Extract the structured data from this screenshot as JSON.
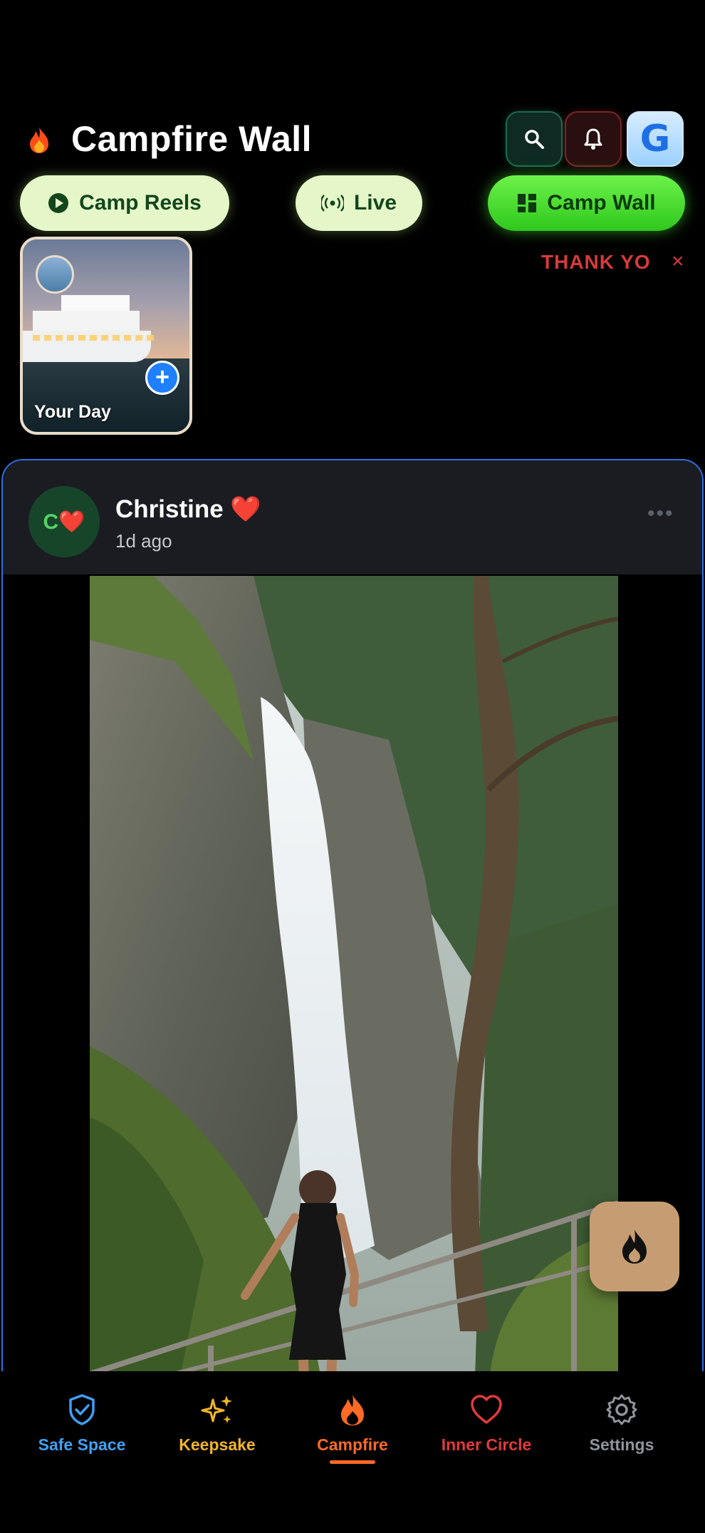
{
  "header": {
    "title": "Campfire Wall",
    "title_icon": "flame-icon",
    "buttons": [
      {
        "name": "search",
        "icon": "search-icon"
      },
      {
        "name": "notifications",
        "icon": "bell-icon"
      },
      {
        "name": "account",
        "icon": "g-logo",
        "letter": "G"
      }
    ]
  },
  "tabs": {
    "reels_label": "Camp Reels",
    "live_label": "Live",
    "wall_label": "Camp Wall",
    "active": "Camp Wall"
  },
  "banner": {
    "text": "THANK YO",
    "close": "×"
  },
  "story": {
    "label": "Your Day",
    "add": "+"
  },
  "post": {
    "avatar_text": "C❤️",
    "author": "Christine ❤️",
    "time": "1d ago",
    "more": "•••"
  },
  "nav": {
    "items": [
      {
        "label": "Safe Space",
        "icon": "shield-check-icon"
      },
      {
        "label": "Keepsake",
        "icon": "sparkles-icon"
      },
      {
        "label": "Campfire",
        "icon": "flame-icon",
        "active": true
      },
      {
        "label": "Inner Circle",
        "icon": "heart-icon"
      },
      {
        "label": "Settings",
        "icon": "gear-icon"
      }
    ]
  },
  "colors": {
    "active_tab": "#3fd62a",
    "tab_bg": "#e5f7c9",
    "accent_blue": "#2f6fe4",
    "campfire": "#ff6a25",
    "fab": "#c69d72"
  }
}
